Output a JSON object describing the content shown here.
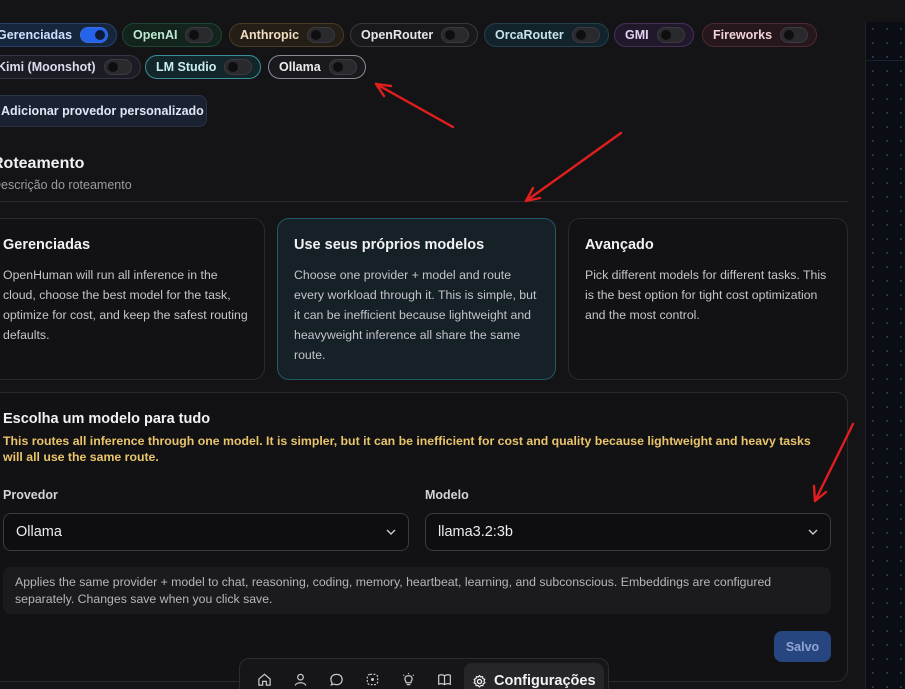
{
  "providers": [
    {
      "label": "Gerenciadas",
      "on": true
    },
    {
      "label": "OpenAI",
      "on": false
    },
    {
      "label": "Anthropic",
      "on": false
    },
    {
      "label": "OpenRouter",
      "on": false
    },
    {
      "label": "OrcaRouter",
      "on": false
    },
    {
      "label": "GMI",
      "on": false
    },
    {
      "label": "Fireworks",
      "on": false
    },
    {
      "label": "Kimi (Moonshot)",
      "on": false
    },
    {
      "label": "LM Studio",
      "on": false
    },
    {
      "label": "Ollama",
      "on": false
    }
  ],
  "add_provider_label": "Adicionar provedor personalizado",
  "routing": {
    "title": "Roteamento",
    "description": "Descrição do roteamento",
    "options": [
      {
        "title": "Gerenciadas",
        "description": "OpenHuman will run all inference in the cloud, choose the best model for the task, optimize for cost, and keep the safest routing defaults."
      },
      {
        "title": "Use seus próprios modelos",
        "description": "Choose one provider + model and route every workload through it. This is simple, but it can be inefficient because lightweight and heavyweight inference all share the same route."
      },
      {
        "title": "Avançado",
        "description": "Pick different models for different tasks. This is the best option for tight cost optimization and the most control."
      }
    ],
    "selected_option": "Use seus próprios modelos"
  },
  "single_model": {
    "title": "Escolha um modelo para tudo",
    "warning": "This routes all inference through one model. It is simpler, but it can be inefficient for cost and quality because lightweight and heavy tasks will all use the same route.",
    "provider_label": "Provedor",
    "provider_value": "Ollama",
    "model_label": "Modelo",
    "model_value": "llama3.2:3b",
    "info": "Applies the same provider + model to chat, reasoning, coding, memory, heartbeat, learning, and subconscious. Embeddings are configured separately. Changes save when you click save.",
    "save_label": "Salvo"
  },
  "nav": {
    "icons": [
      "home-icon",
      "user-icon",
      "chat-icon",
      "brain-icon",
      "lightbulb-icon",
      "book-icon"
    ],
    "active_label": "Configurações",
    "active_icon": "gear-icon"
  },
  "colors": {
    "accent_toggle": "#2563eb",
    "warning_text": "#e9c46a",
    "annotation_arrow": "#e01e1e"
  }
}
